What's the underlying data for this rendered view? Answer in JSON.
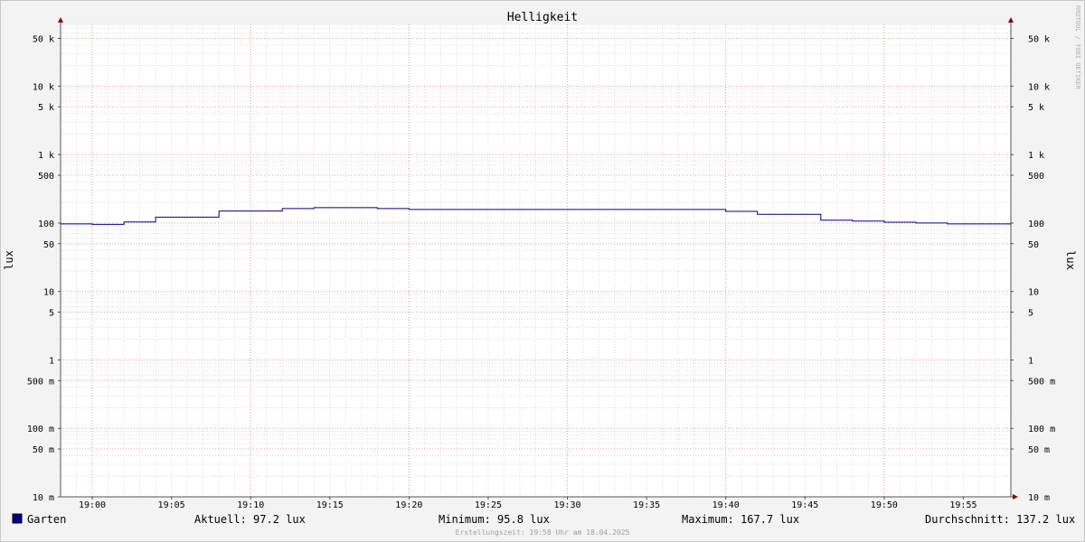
{
  "chart_data": {
    "type": "line",
    "title": "Helligkeit",
    "ylabel_left": "lux",
    "ylabel_right": "lux",
    "watermark": "RRDTOOL / TOBI OETIKER",
    "y_scale": "log",
    "ylim": [
      0.01,
      80000
    ],
    "y_ticks": [
      {
        "v": 50000,
        "label": "50 k"
      },
      {
        "v": 10000,
        "label": "10 k"
      },
      {
        "v": 5000,
        "label": "5 k"
      },
      {
        "v": 1000,
        "label": "1 k"
      },
      {
        "v": 500,
        "label": "500"
      },
      {
        "v": 100,
        "label": "100"
      },
      {
        "v": 50,
        "label": "50"
      },
      {
        "v": 10,
        "label": "10"
      },
      {
        "v": 5,
        "label": "5"
      },
      {
        "v": 1,
        "label": "1"
      },
      {
        "v": 0.5,
        "label": "500 m"
      },
      {
        "v": 0.1,
        "label": "100 m"
      },
      {
        "v": 0.05,
        "label": "50 m"
      },
      {
        "v": 0.01,
        "label": "10 m"
      }
    ],
    "xlim": [
      "18:58",
      "19:58"
    ],
    "x_ticks": [
      "19:00",
      "19:05",
      "19:10",
      "19:15",
      "19:20",
      "19:25",
      "19:30",
      "19:35",
      "19:40",
      "19:45",
      "19:50",
      "19:55"
    ],
    "grid": true,
    "series": [
      {
        "name": "Garten",
        "color": "#00008b",
        "step": true,
        "points": [
          {
            "t": "18:58",
            "v": 97
          },
          {
            "t": "19:00",
            "v": 95.8
          },
          {
            "t": "19:02",
            "v": 104
          },
          {
            "t": "19:04",
            "v": 122
          },
          {
            "t": "19:08",
            "v": 150
          },
          {
            "t": "19:12",
            "v": 163
          },
          {
            "t": "19:14",
            "v": 167.7
          },
          {
            "t": "19:18",
            "v": 163
          },
          {
            "t": "19:20",
            "v": 158
          },
          {
            "t": "19:40",
            "v": 148
          },
          {
            "t": "19:42",
            "v": 134
          },
          {
            "t": "19:46",
            "v": 110
          },
          {
            "t": "19:48",
            "v": 107
          },
          {
            "t": "19:50",
            "v": 103
          },
          {
            "t": "19:52",
            "v": 100
          },
          {
            "t": "19:54",
            "v": 97.2
          },
          {
            "t": "19:58",
            "v": 97.2
          }
        ]
      }
    ],
    "legend": {
      "placement": "bottom",
      "label": "Garten",
      "color": "#00008b",
      "stats": [
        {
          "key": "current",
          "text": "Aktuell:  97.2 lux"
        },
        {
          "key": "minimum",
          "text": "Minimum:  95.8 lux"
        },
        {
          "key": "maximum",
          "text": "Maximum: 167.7 lux"
        },
        {
          "key": "average",
          "text": "Durchschnitt: 137.2 lux"
        }
      ]
    },
    "footer": "Erstellungszeit: 19:58 Uhr am 18.04.2025"
  }
}
